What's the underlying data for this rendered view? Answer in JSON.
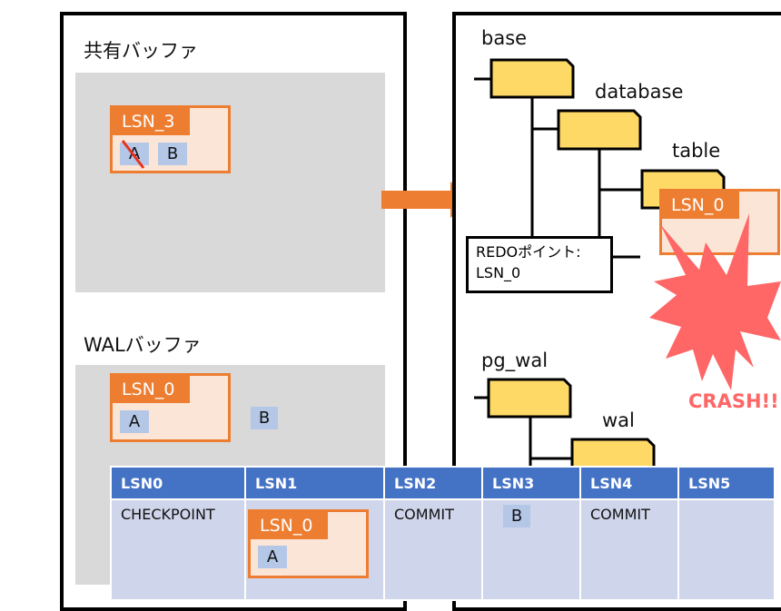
{
  "shared_buffer": {
    "title": "共有バッファ",
    "record": {
      "lsn": "LSN_3",
      "cells": [
        "A",
        "B"
      ],
      "struck_cell": "A"
    }
  },
  "wal_buffer": {
    "title": "WALバッファ",
    "record": {
      "lsn": "LSN_0",
      "cells": [
        "A"
      ]
    },
    "loose_cell": "B"
  },
  "storage": {
    "folders": {
      "base": "base",
      "database": "database",
      "table": "table",
      "pg_wal": "pg_wal",
      "wal": "wal"
    },
    "redo_point": {
      "line1": "REDOポイント:",
      "line2": "LSN_0"
    },
    "table_record": {
      "lsn": "LSN_0"
    },
    "crash_label": "CRASH!!"
  },
  "wal_log": {
    "headers": [
      "LSN0",
      "LSN1",
      "LSN2",
      "LSN3",
      "LSN4",
      "LSN5"
    ],
    "cells": [
      "CHECKPOINT",
      "",
      "COMMIT",
      "",
      "COMMIT",
      ""
    ],
    "lsn1_record": {
      "lsn": "LSN_0",
      "cells": [
        "A"
      ]
    },
    "lsn3_cell": "B"
  },
  "colors": {
    "orange": "#ed7d31",
    "folder": "#ffd966",
    "crash": "#ff6666",
    "header": "#4472c4"
  }
}
